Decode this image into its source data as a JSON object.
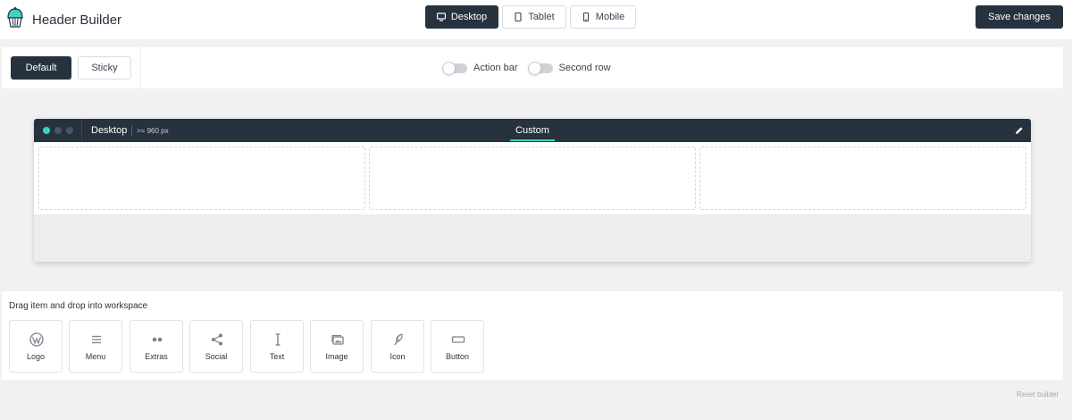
{
  "header": {
    "title": "Header Builder",
    "device_tabs": [
      {
        "label": "Desktop",
        "icon": "monitor-icon",
        "active": true
      },
      {
        "label": "Tablet",
        "icon": "tablet-icon",
        "active": false
      },
      {
        "label": "Mobile",
        "icon": "phone-icon",
        "active": false
      }
    ],
    "save_label": "Save changes"
  },
  "modes": {
    "default_label": "Default",
    "sticky_label": "Sticky",
    "toggles": [
      {
        "label": "Action bar",
        "on": false
      },
      {
        "label": "Second row",
        "on": false
      }
    ]
  },
  "workspace": {
    "device": "Desktop",
    "size": ">= 960 px",
    "tab": "Custom",
    "edit_icon": "pencil-icon"
  },
  "items": {
    "title": "Drag item and drop into workspace",
    "list": [
      {
        "label": "Logo",
        "icon": "wordpress-icon"
      },
      {
        "label": "Menu",
        "icon": "menu-lines-icon"
      },
      {
        "label": "Extras",
        "icon": "dots-icon"
      },
      {
        "label": "Social",
        "icon": "share-icon"
      },
      {
        "label": "Text",
        "icon": "text-cursor-icon"
      },
      {
        "label": "Image",
        "icon": "image-icon"
      },
      {
        "label": "Icon",
        "icon": "feather-icon"
      },
      {
        "label": "Button",
        "icon": "button-icon"
      }
    ]
  },
  "footer": {
    "reset_label": "Reset builder"
  },
  "colors": {
    "accent": "#3ed2c1",
    "dark": "#27323f"
  }
}
